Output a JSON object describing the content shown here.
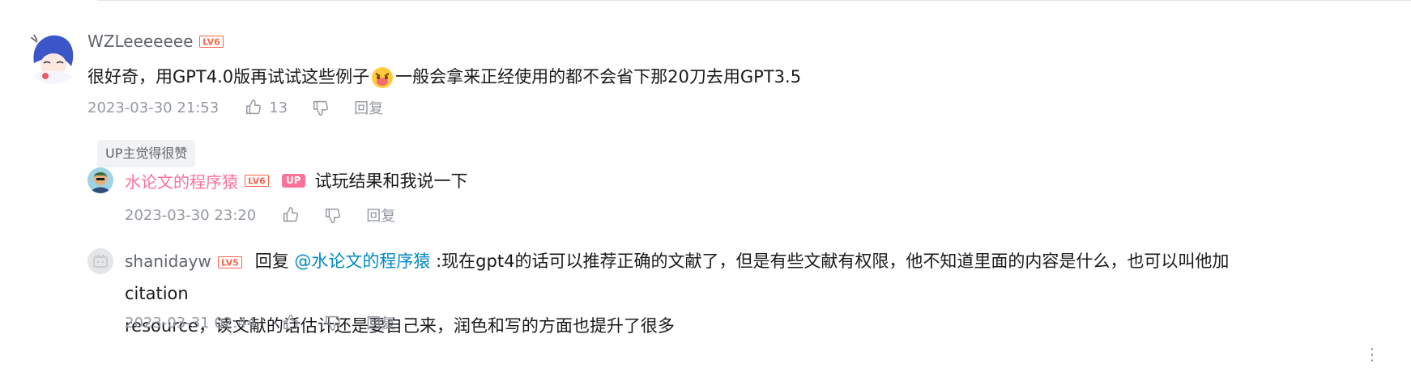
{
  "main_comment": {
    "username": "WZLeeeeeee",
    "level": "LV6",
    "text_before_emoji": "很好奇，用GPT4.0版再试试这些例子",
    "emoji": "doge-face-emoji",
    "text_after_emoji": "一般会拿来正经使用的都不会省下那20刀去用GPT3.5",
    "time": "2023-03-30 21:53",
    "likes": "13",
    "reply_label": "回复",
    "tag": "UP主觉得很赞"
  },
  "replies": [
    {
      "username": "水论文的程序猿",
      "level": "LV6",
      "up_badge": "UP",
      "text": "试玩结果和我说一下",
      "time": "2023-03-30 23:20",
      "reply_label": "回复"
    },
    {
      "username": "shanidayw",
      "level": "LV5",
      "reply_prefix": "回复",
      "mention": "@水论文的程序猿",
      "text_line1": ":现在gpt4的话可以推荐正确的文献了，但是有些文献有权限，他不知道里面的内容是什么，也可以叫他加citation",
      "text_line2": "resource，读文献的话估计还是要自己来，润色和写的方面也提升了很多",
      "time": "2023-03-31 02:44",
      "reply_label": "回复"
    }
  ],
  "colors": {
    "up_pink": "#fb7299",
    "link_blue": "#008ac5",
    "level_red": "#f6654c"
  }
}
